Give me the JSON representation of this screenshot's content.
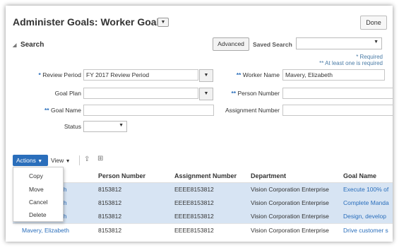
{
  "header": {
    "title": "Administer Goals: Worker Goals",
    "title_menu_icon": "chevron-down-icon",
    "done_label": "Done"
  },
  "search": {
    "heading": "Search",
    "advanced_label": "Advanced",
    "saved_search_label": "Saved Search",
    "saved_search_value": "",
    "required_note": "* Required",
    "at_least_one_note": "** At least one is required"
  },
  "fields": {
    "review_period": {
      "marker": "*",
      "label": "Review Period",
      "value": "FY 2017 Review Period"
    },
    "worker_name": {
      "marker": "**",
      "label": "Worker Name",
      "value": "Mavery, Elizabeth"
    },
    "goal_plan": {
      "marker": "",
      "label": "Goal Plan",
      "value": ""
    },
    "person_number": {
      "marker": "**",
      "label": "Person Number",
      "value": ""
    },
    "goal_name": {
      "marker": "**",
      "label": "Goal Name",
      "value": ""
    },
    "assignment_number": {
      "marker": "",
      "label": "Assignment Number",
      "value": ""
    },
    "status": {
      "marker": "",
      "label": "Status",
      "value": ""
    }
  },
  "toolbar": {
    "actions_label": "Actions",
    "view_label": "View",
    "export_icon": "export-icon",
    "freeze_icon": "freeze-icon"
  },
  "actions_menu": [
    "Copy",
    "Move",
    "Cancel",
    "Delete"
  ],
  "table": {
    "columns": [
      "Person Number",
      "Assignment Number",
      "Department",
      "Goal Name"
    ],
    "rows": [
      {
        "worker": "Mavery, Elizabeth",
        "worker_visible": "beth",
        "person_number": "8153812",
        "assignment_number": "EEEE8153812",
        "department": "Vision Corporation Enterprise",
        "goal_name": "Execute 100% of",
        "selected": true
      },
      {
        "worker": "Mavery, Elizabeth",
        "worker_visible": "beth",
        "person_number": "8153812",
        "assignment_number": "EEEE8153812",
        "department": "Vision Corporation Enterprise",
        "goal_name": "Complete Manda",
        "selected": true
      },
      {
        "worker": "Mavery, Elizabeth",
        "worker_visible": "beth",
        "person_number": "8153812",
        "assignment_number": "EEEE8153812",
        "department": "Vision Corporation Enterprise",
        "goal_name": "Design, develop",
        "selected": true
      },
      {
        "worker": "Mavery, Elizabeth",
        "worker_visible": "Mavery, Elizabeth",
        "person_number": "8153812",
        "assignment_number": "EEEE8153812",
        "department": "Vision Corporation Enterprise",
        "goal_name": "Drive customer s",
        "selected": false
      }
    ]
  },
  "colors": {
    "accent": "#2a6ebb",
    "selected_row": "#d7e4f3"
  }
}
